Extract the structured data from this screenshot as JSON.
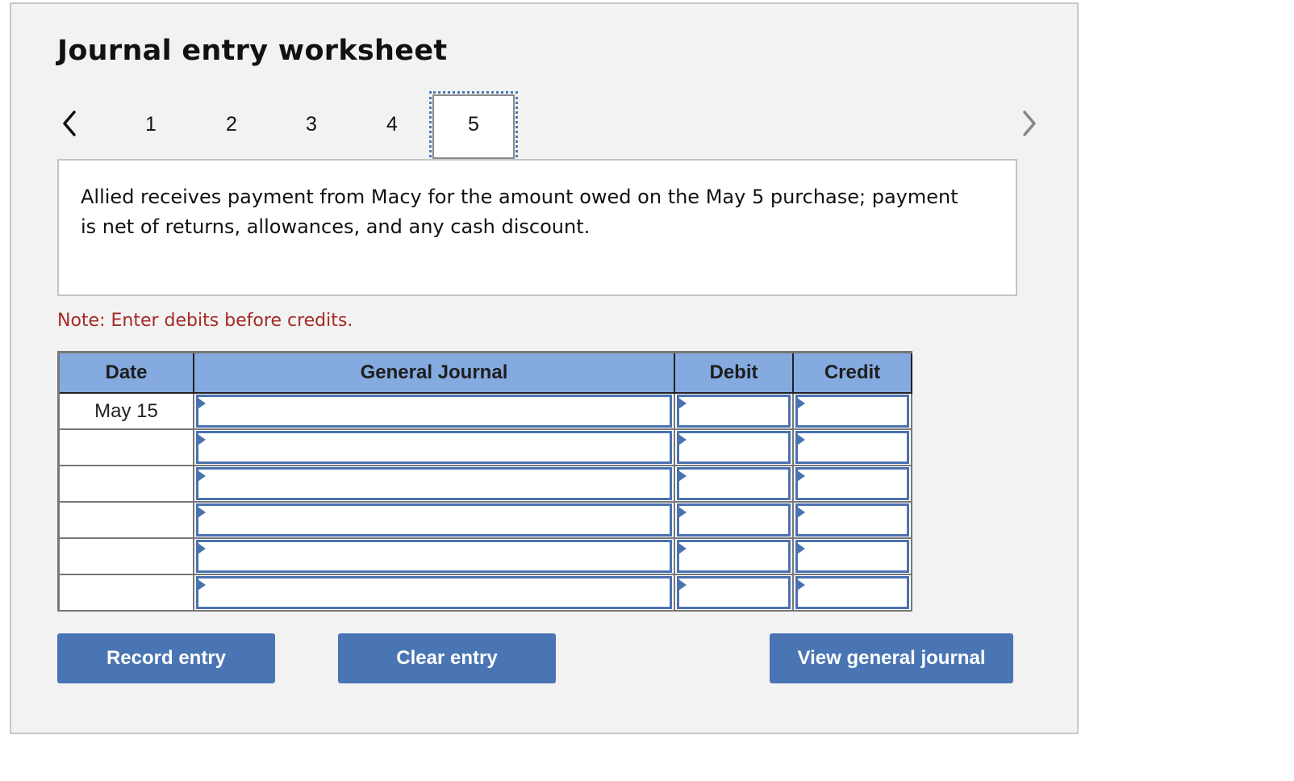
{
  "header": {
    "title": "Journal entry worksheet"
  },
  "navigation": {
    "prev_icon": "chevron-left-icon",
    "next_icon": "chevron-right-icon",
    "steps": [
      {
        "label": "1",
        "active": false
      },
      {
        "label": "2",
        "active": false
      },
      {
        "label": "3",
        "active": false
      },
      {
        "label": "4",
        "active": false
      },
      {
        "label": "5",
        "active": true
      }
    ]
  },
  "question": {
    "text": "Allied receives payment from Macy for the amount owed on the May 5 purchase; payment is net of returns, allowances, and any cash discount."
  },
  "note": "Note: Enter debits before credits.",
  "journal": {
    "columns": [
      "Date",
      "General Journal",
      "Debit",
      "Credit"
    ],
    "rows": [
      {
        "date": "May 15",
        "account": "",
        "debit": "",
        "credit": ""
      },
      {
        "date": "",
        "account": "",
        "debit": "",
        "credit": ""
      },
      {
        "date": "",
        "account": "",
        "debit": "",
        "credit": ""
      },
      {
        "date": "",
        "account": "",
        "debit": "",
        "credit": ""
      },
      {
        "date": "",
        "account": "",
        "debit": "",
        "credit": ""
      },
      {
        "date": "",
        "account": "",
        "debit": "",
        "credit": ""
      }
    ]
  },
  "buttons": {
    "record": "Record entry",
    "clear": "Clear entry",
    "view": "View general journal"
  },
  "colors": {
    "accent": "#4a75b4",
    "header_bg": "#84aadf",
    "note": "#a52a25",
    "panel_bg": "#f2f2f2"
  }
}
